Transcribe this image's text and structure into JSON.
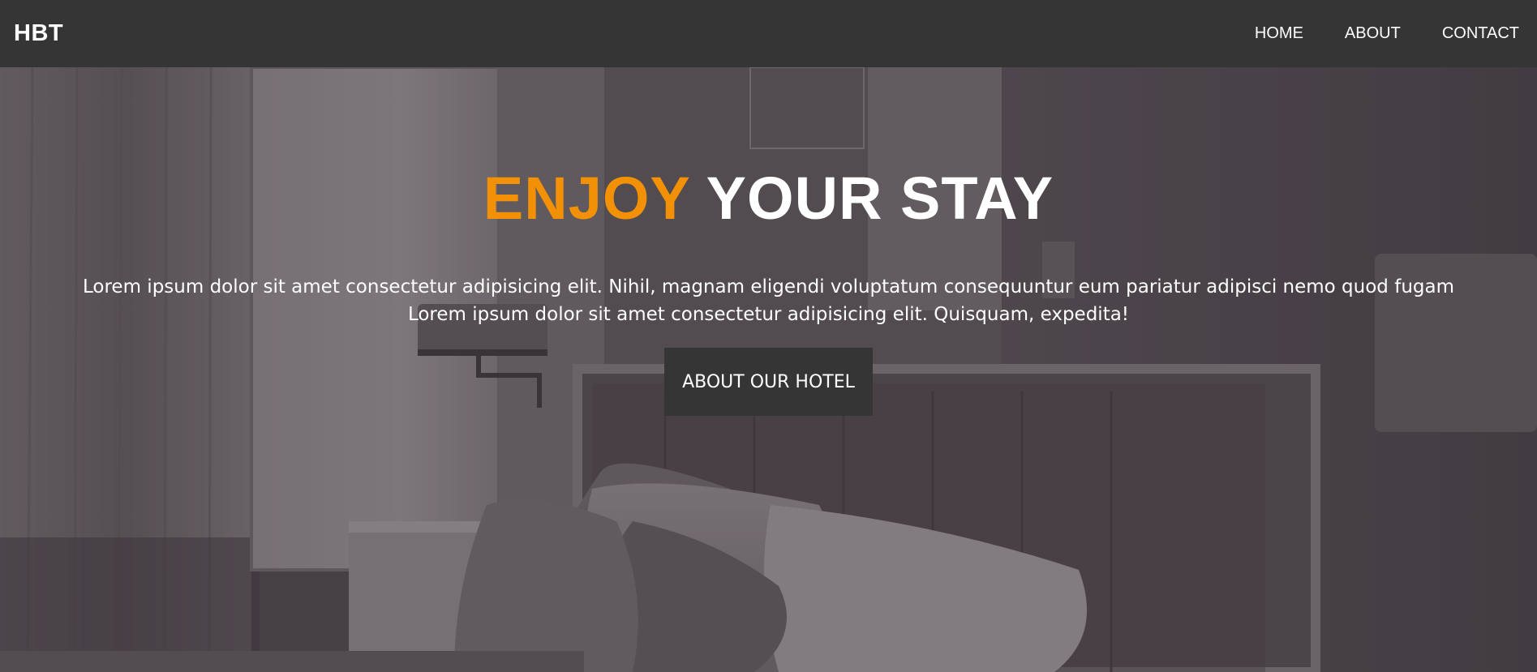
{
  "navbar": {
    "brand": "HBT",
    "links": [
      "HOME",
      "ABOUT",
      "CONTACT"
    ]
  },
  "hero": {
    "heading_accent": "ENJOY",
    "heading_rest": " YOUR STAY",
    "text_line1": "Lorem ipsum dolor sit amet consectetur adipisicing elit. Nihil, magnam eligendi voluptatum consequuntur eum pariatur adipisci nemo quod fugam",
    "text_line2": "Lorem ipsum dolor sit amet consectetur adipisicing elit. Quisquam, expedita!",
    "button_label": "ABOUT OUR HOTEL"
  },
  "colors": {
    "navbar_bg": "#353535",
    "accent": "#f39106",
    "text": "#ffffff",
    "button_bg": "#353535"
  }
}
